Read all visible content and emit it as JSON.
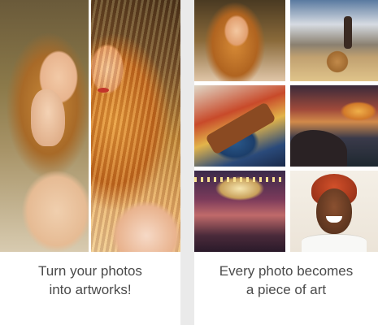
{
  "screens": [
    {
      "caption_line_1": "Turn your photos",
      "caption_line_2": "into artworks!"
    },
    {
      "caption_line_1": "Every photo becomes",
      "caption_line_2": "a piece of art"
    }
  ],
  "colors": {
    "background": "#eaeaea",
    "card": "#ffffff",
    "caption_text": "#4a4a4a"
  }
}
